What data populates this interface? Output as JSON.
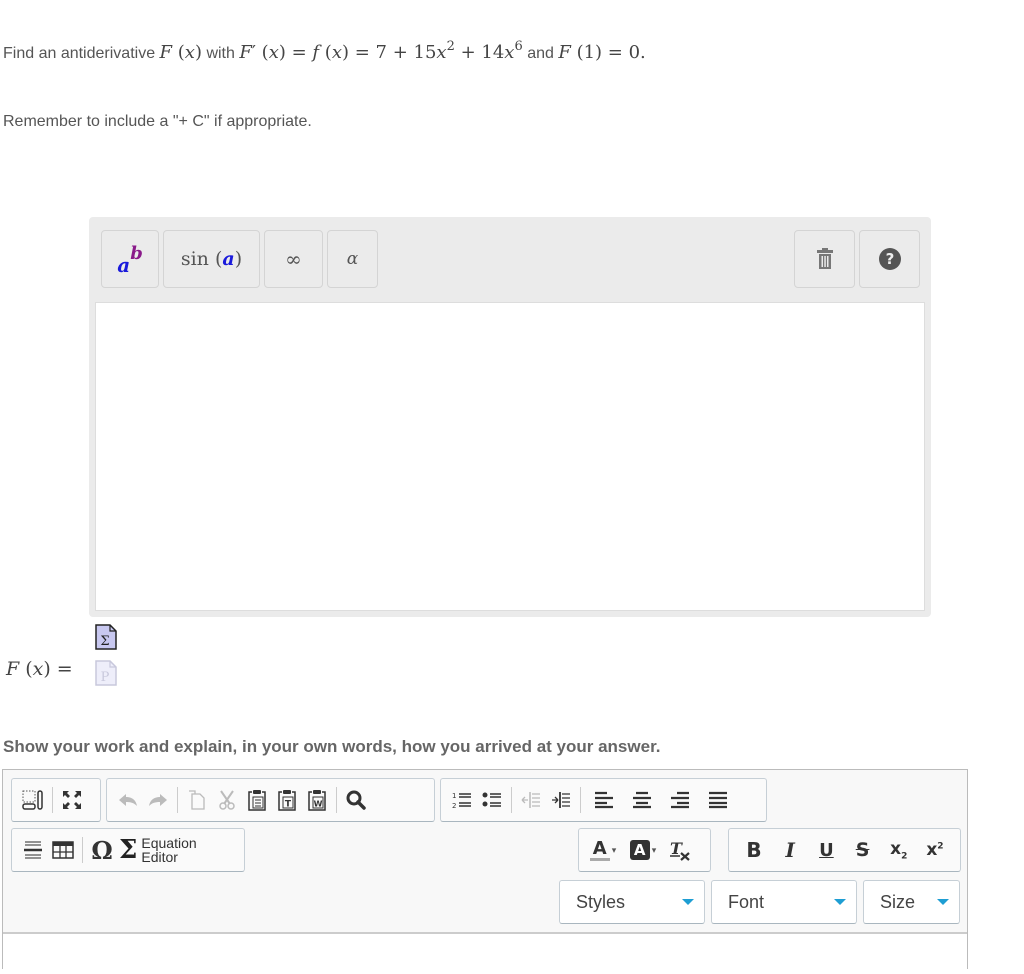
{
  "question": {
    "prefix": "Find an antiderivative",
    "F_of_x": "F (x)",
    "with": "with",
    "derivative_expr": "F′ (x) = f (x) = 7 + 15x",
    "exp1": "2",
    "mid_expr": " + 14x",
    "exp2": "6",
    "and": "and",
    "condition": "F (1) = 0."
  },
  "reminder": "Remember to include a \"+ C\" if appropriate.",
  "math_editor": {
    "buttons": [
      {
        "name": "power-button",
        "base": "a",
        "sup": "b"
      },
      {
        "name": "function-button",
        "label": "sin",
        "arg": "a"
      },
      {
        "name": "infinity-button",
        "label": "∞"
      },
      {
        "name": "greek-button",
        "label": "α"
      }
    ],
    "trash_icon": "trash-icon",
    "help_icon": "help-icon",
    "input_value": ""
  },
  "answer_label": "F (x) =",
  "work_prompt": "Show your work and explain, in your own words, how you arrived at your answer.",
  "rich_editor": {
    "equation_editor_label_1": "Equation",
    "equation_editor_label_2": "Editor",
    "styles_label": "Styles",
    "font_label": "Font",
    "size_label": "Size",
    "body_value": ""
  },
  "colors": {
    "math_blue": "#1a1adb",
    "math_purple": "#8a1a8a",
    "combo_caret": "#1e9ed3"
  }
}
